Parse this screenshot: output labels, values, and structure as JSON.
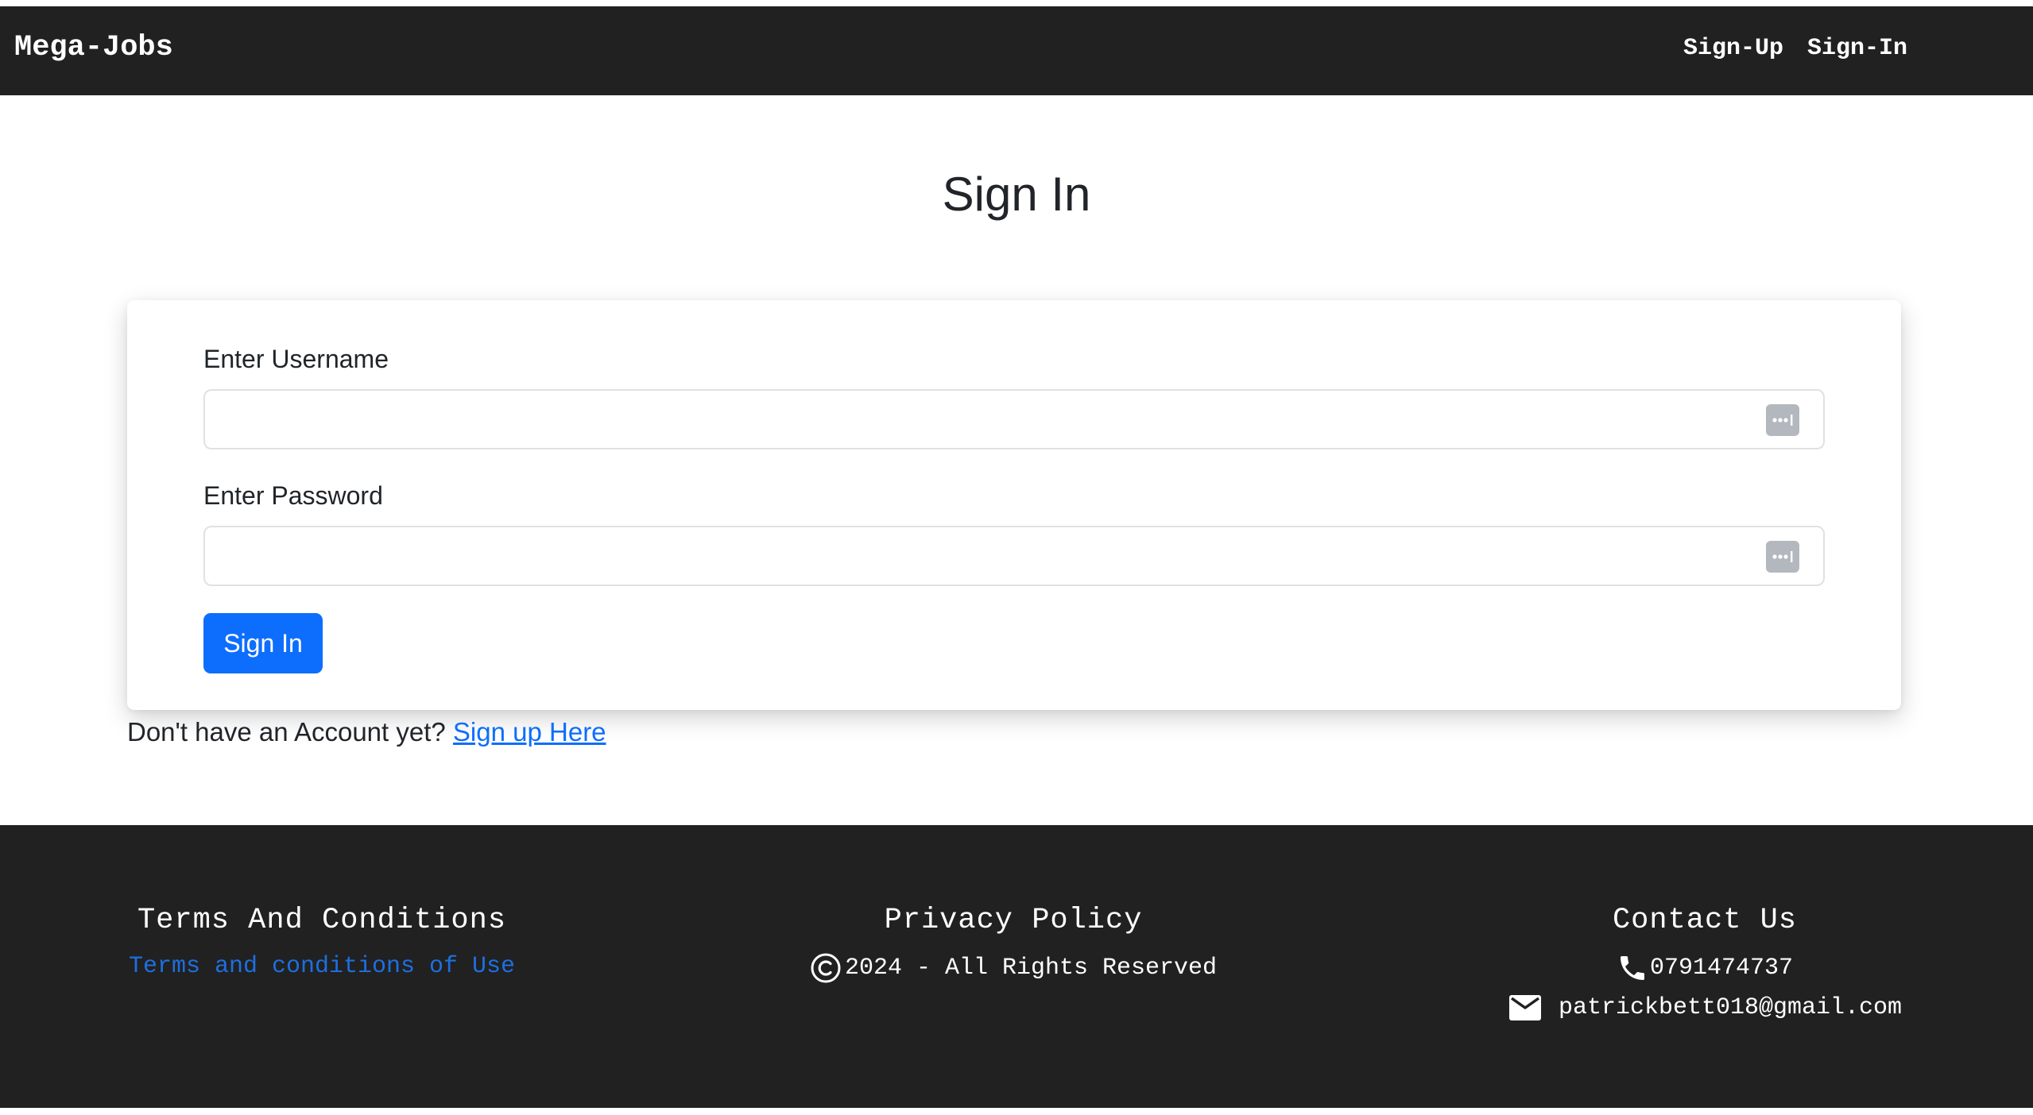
{
  "nav": {
    "brand": "Mega-Jobs",
    "links": [
      "Sign-Up",
      "Sign-In"
    ]
  },
  "page": {
    "title": "Sign In"
  },
  "form": {
    "username_label": "Enter Username",
    "username_value": "",
    "password_label": "Enter Password",
    "password_value": "",
    "submit_label": "Sign In"
  },
  "account": {
    "prompt": "Don't have an Account yet?",
    "link": "Sign up Here"
  },
  "footer": {
    "terms_heading": "Terms And Conditions",
    "terms_link": "Terms and conditions of Use",
    "privacy_heading": "Privacy Policy",
    "copyright": "2024 - All Rights Reserved",
    "contact_heading": "Contact Us",
    "phone": "0791474737",
    "email": "patrickbett018@gmail.com"
  },
  "colors": {
    "navbar_bg": "#212121",
    "accent": "#0d6efd",
    "footer_link": "#1d6fe0",
    "text": "#212529"
  },
  "icons": {
    "password_manager": "password-manager-key-icon",
    "copyright": "copyright-icon",
    "phone": "phone-icon",
    "email": "email-icon"
  }
}
